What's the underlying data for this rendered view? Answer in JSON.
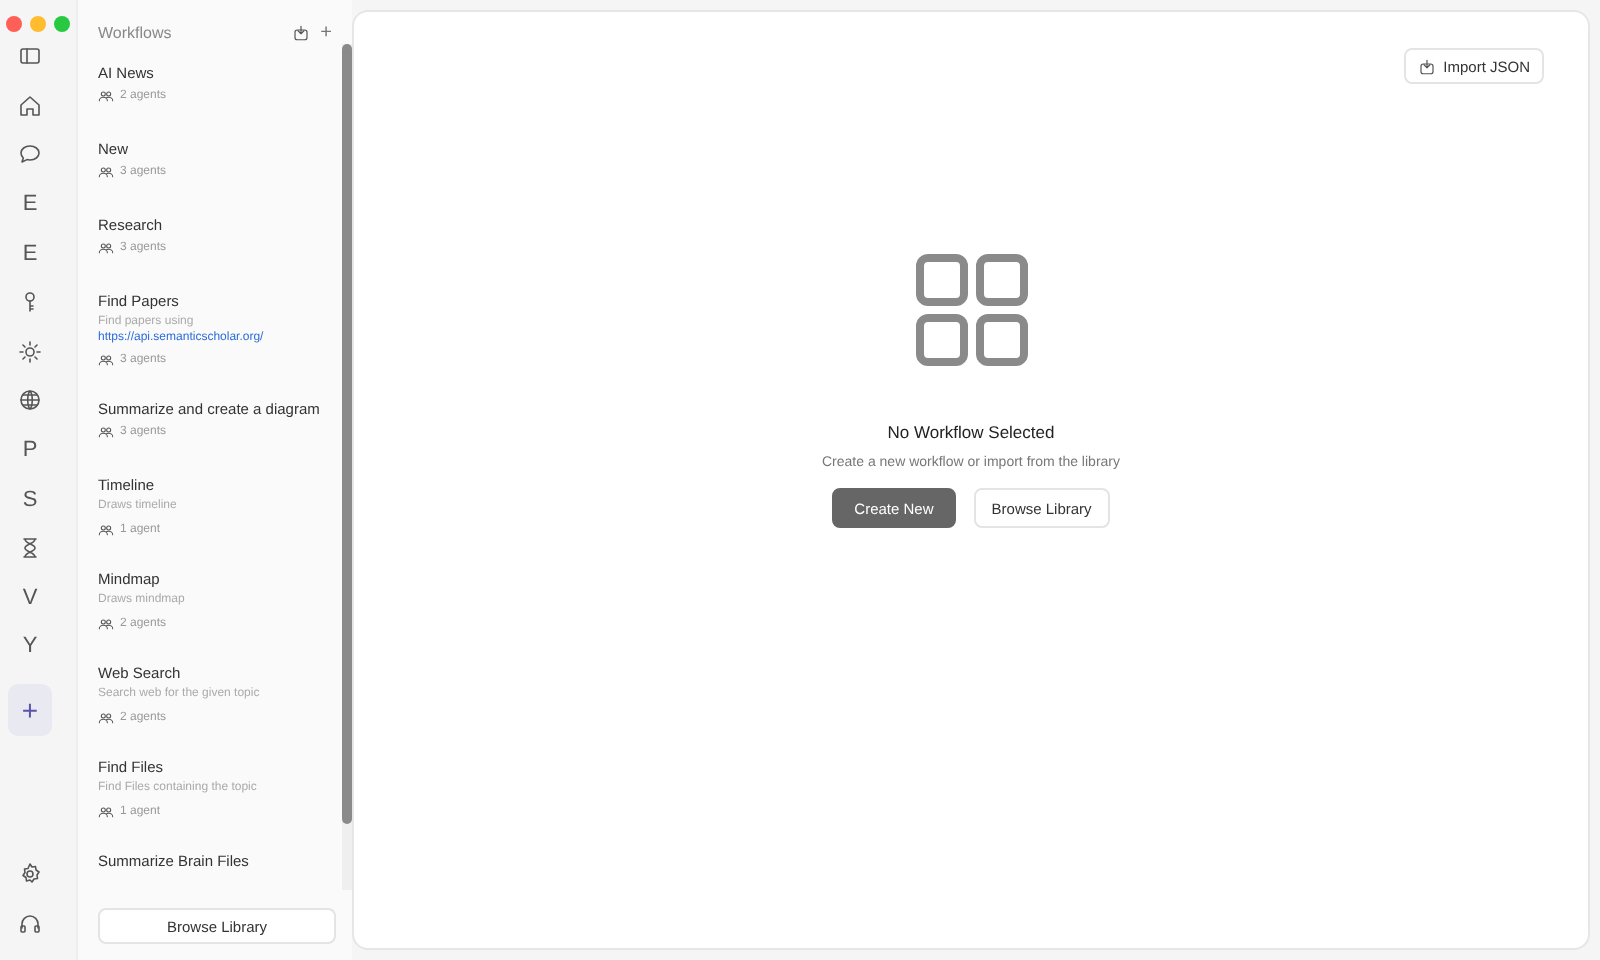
{
  "rail": {
    "items": [
      {
        "kind": "icon",
        "selected": false
      },
      {
        "kind": "icon",
        "selected": false
      },
      {
        "kind": "letter",
        "label": "E",
        "selected": false
      },
      {
        "kind": "letter",
        "label": "E",
        "selected": false
      },
      {
        "kind": "icon",
        "selected": false
      },
      {
        "kind": "icon",
        "selected": false
      },
      {
        "kind": "icon",
        "selected": false
      },
      {
        "kind": "letter",
        "label": "P",
        "selected": false
      },
      {
        "kind": "letter",
        "label": "S",
        "selected": false
      },
      {
        "kind": "icon",
        "selected": false
      },
      {
        "kind": "letter",
        "label": "V",
        "selected": false
      },
      {
        "kind": "letter",
        "label": "Y",
        "selected": false
      },
      {
        "kind": "add",
        "label": "+",
        "selected": true
      }
    ]
  },
  "sidebar": {
    "title": "Workflows",
    "add_label": "+",
    "browse_button": "Browse Library",
    "workflows": [
      {
        "name": "AI News",
        "agents": "2 agents"
      },
      {
        "name": "New",
        "agents": "3 agents"
      },
      {
        "name": "Research",
        "agents": "3 agents"
      },
      {
        "name": "Find Papers",
        "description": "Find papers using",
        "link": "https://api.semanticscholar.org/",
        "agents": "3 agents"
      },
      {
        "name": "Summarize and create a diagram",
        "agents": "3 agents"
      },
      {
        "name": "Timeline",
        "description": "Draws timeline",
        "agents": "1 agent"
      },
      {
        "name": "Mindmap",
        "description": "Draws mindmap",
        "agents": "2 agents"
      },
      {
        "name": "Web Search",
        "description": "Search web for the given topic",
        "agents": "2 agents"
      },
      {
        "name": "Find Files",
        "description": "Find Files containing the topic",
        "agents": "1 agent"
      },
      {
        "name": "Summarize Brain Files"
      }
    ]
  },
  "main": {
    "import_button": "Import JSON",
    "empty_title": "No Workflow Selected",
    "empty_text": "Create a new workflow or import from the library",
    "create_button": "Create New",
    "browse_button": "Browse Library"
  }
}
